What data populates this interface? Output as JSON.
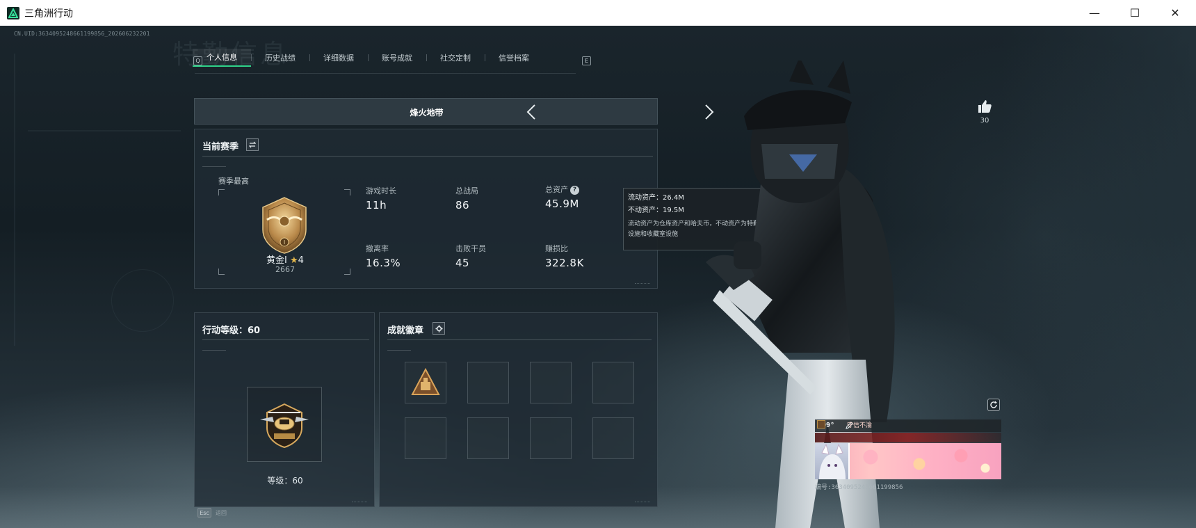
{
  "window": {
    "title": "三角洲行动",
    "minimize_glyph": "—",
    "maximize_glyph": "☐",
    "close_glyph": "✕"
  },
  "uid_line": "CN.UID:3634095248661199856_202606232201",
  "watermark": "特勤信息",
  "tabs": {
    "prev_key": "Q",
    "next_key": "E",
    "items": [
      {
        "label": "个人信息",
        "active": true
      },
      {
        "label": "历史战绩",
        "active": false
      },
      {
        "label": "详细数据",
        "active": false
      },
      {
        "label": "账号成就",
        "active": false
      },
      {
        "label": "社交定制",
        "active": false
      },
      {
        "label": "信誉档案",
        "active": false
      }
    ]
  },
  "mode": {
    "title": "烽火地带",
    "prev_icon": "chevron-left-icon",
    "next_icon": "chevron-right-icon"
  },
  "season": {
    "title": "当前赛季",
    "swap_icon": "swap-icon",
    "best_label": "赛季最高",
    "rank_name": "黄金Ⅰ",
    "rank_star": "★",
    "rank_stars": "4",
    "rank_score": "2667",
    "stats": {
      "play_time": {
        "label": "游戏时长",
        "value": "11h"
      },
      "total_matches": {
        "label": "总战局",
        "value": "86"
      },
      "total_assets": {
        "label": "总资产",
        "value": "45.9M",
        "help": "?"
      },
      "extract_rate": {
        "label": "撤离率",
        "value": "16.3%"
      },
      "kills": {
        "label": "击败干员",
        "value": "45"
      },
      "profit_ratio": {
        "label": "赚损比",
        "value": "322.8K"
      }
    }
  },
  "tooltip": {
    "liquid": "流动资产：26.4M",
    "fixed": "不动资产：19.5M",
    "desc": "流动资产为仓库资产和哈夫币，不动资产为特勤处设施和收藏室设施"
  },
  "level": {
    "title": "行动等级：60",
    "text": "等级：60"
  },
  "badges": {
    "title": "成就徽章",
    "gear_icon": "gear-icon"
  },
  "profile": {
    "like_count": "30",
    "like_icon": "thumbs-up-icon",
    "refresh_icon": "refresh-icon"
  },
  "namecard": {
    "name": "099°",
    "tag": "守信不渝",
    "id_line": "编号:3634095248661199856"
  },
  "footer": {
    "esc_key": "Esc",
    "esc_label": "返回"
  },
  "colors": {
    "accent": "#2fd38a",
    "panel": "#202c34",
    "tag_red": "#9a1e1e"
  }
}
